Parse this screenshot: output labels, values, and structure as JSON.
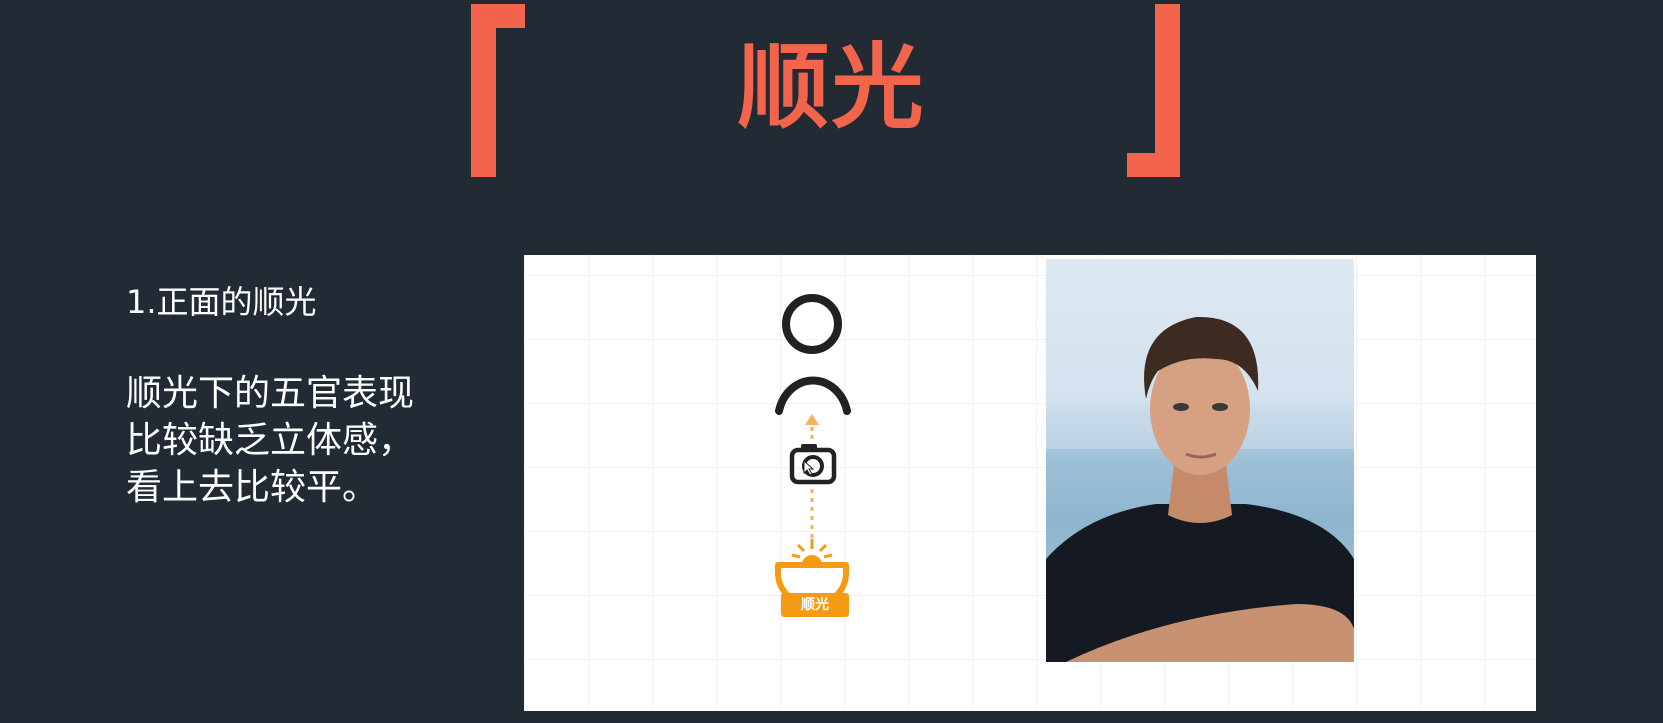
{
  "slide": {
    "title": "顺光",
    "subheading": "1.正面的顺光",
    "description_lines": [
      "顺光下的五官表现",
      "比较缺乏立体感，",
      "看上去比较平。"
    ]
  },
  "diagram": {
    "light_label": "顺光",
    "icons": [
      "person-icon",
      "camera-icon",
      "light-source-icon"
    ]
  },
  "colors": {
    "background": "#222a34",
    "accent": "#f2644c",
    "light_orange": "#f59a14",
    "text": "#ffffff"
  }
}
